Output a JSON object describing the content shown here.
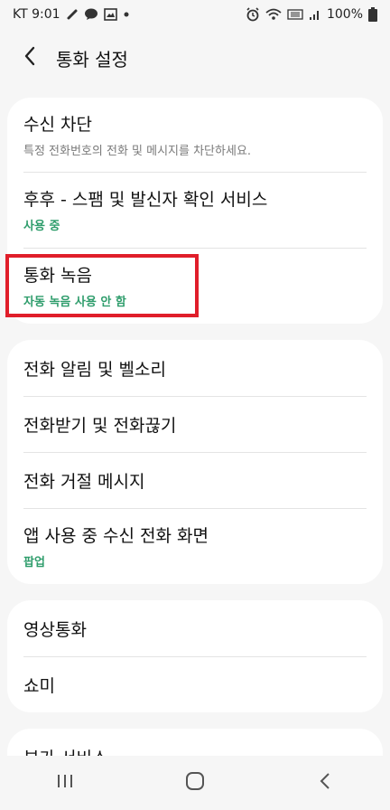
{
  "status_bar": {
    "carrier_time": "KT 9:01",
    "battery": "100%",
    "icons": [
      "link-icon",
      "message-icon",
      "gallery-icon",
      "dot-icon",
      "alarm-icon",
      "wifi-icon",
      "lte-icon",
      "signal-icon",
      "battery-icon"
    ]
  },
  "header": {
    "back_icon": "chevron-left-icon",
    "title": "통화 설정"
  },
  "sections": [
    {
      "items": [
        {
          "title": "수신 차단",
          "subtitle": "특정 전화번호의 전화 및 메시지를 차단하세요."
        },
        {
          "title": "후후 - 스팸 및 발신자 확인 서비스",
          "subtitle": "사용 중"
        },
        {
          "title": "통화 녹음",
          "subtitle": "자동 녹음 사용 안 함"
        }
      ]
    },
    {
      "items": [
        {
          "title": "전화 알림 및 벨소리"
        },
        {
          "title": "전화받기 및 전화끊기"
        },
        {
          "title": "전화 거절 메시지"
        },
        {
          "title": "앱 사용 중 수신 전화 화면",
          "subtitle": "팝업"
        }
      ]
    },
    {
      "items": [
        {
          "title": "영상통화"
        },
        {
          "title": "쇼미"
        }
      ]
    },
    {
      "items": [
        {
          "title": "부가 서비스"
        }
      ]
    }
  ],
  "colors": {
    "accent_green": "#2f9d6c",
    "highlight_red": "#e01e2a",
    "background": "#f6f6f6"
  },
  "nav_bar": {
    "icons": [
      "recents-icon",
      "home-icon",
      "back-icon"
    ]
  }
}
